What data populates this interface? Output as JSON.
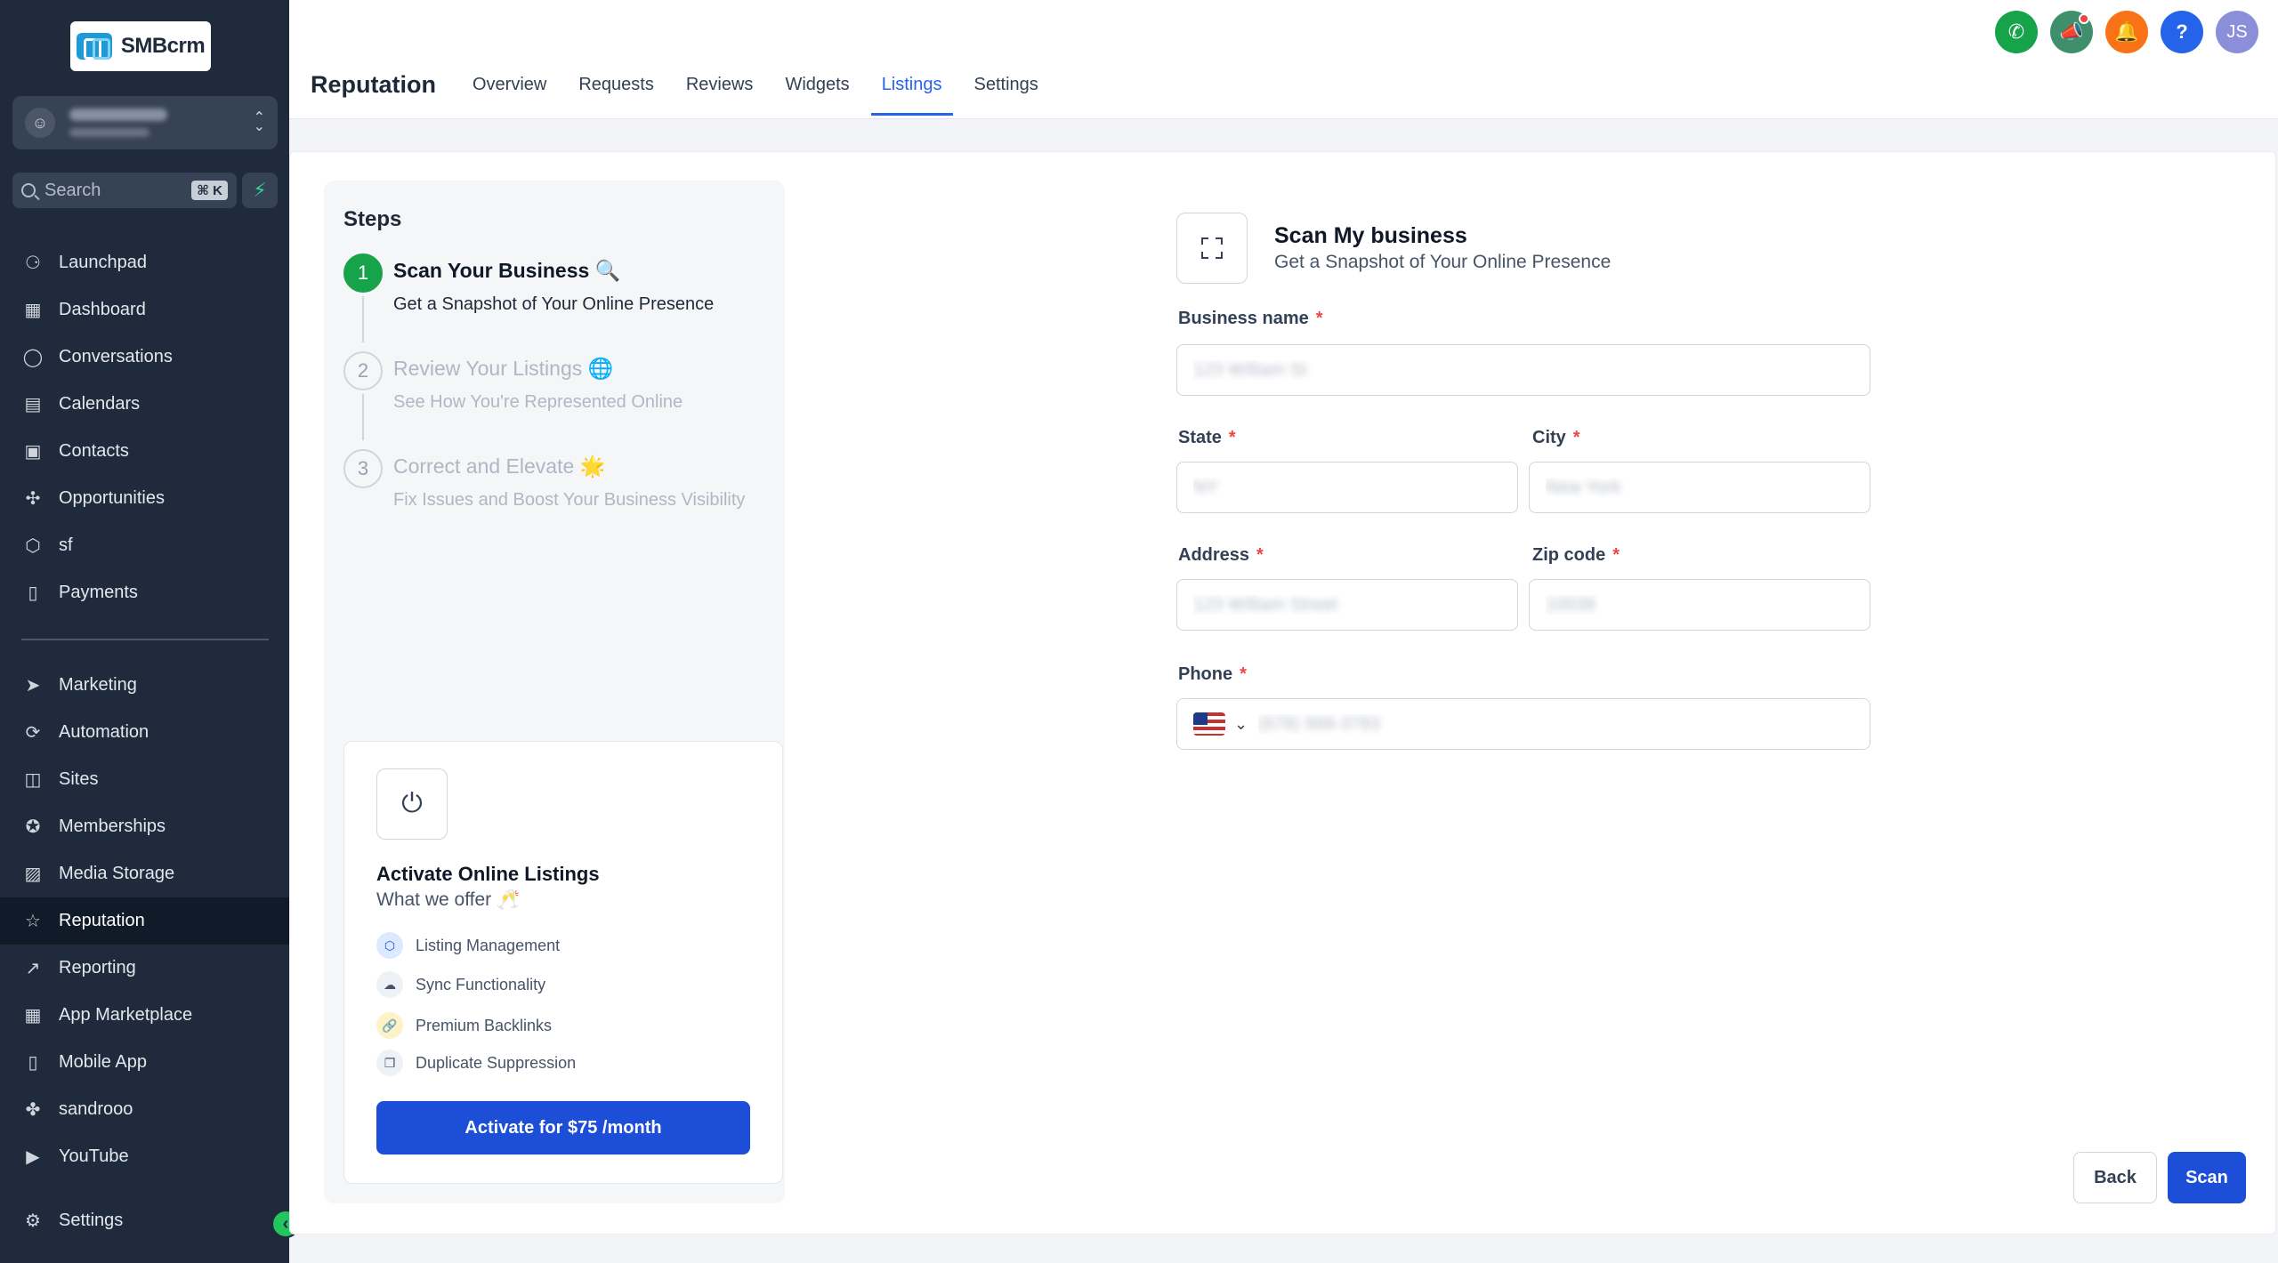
{
  "brand": {
    "name": "SMBcrm"
  },
  "search": {
    "label": "Search",
    "shortcut": "⌘ K"
  },
  "sidebar": {
    "items": [
      {
        "label": "Launchpad",
        "icon": "rocket-icon"
      },
      {
        "label": "Dashboard",
        "icon": "grid-icon"
      },
      {
        "label": "Conversations",
        "icon": "chat-icon"
      },
      {
        "label": "Calendars",
        "icon": "calendar-icon"
      },
      {
        "label": "Contacts",
        "icon": "contacts-icon"
      },
      {
        "label": "Opportunities",
        "icon": "opportunities-icon"
      },
      {
        "label": "sf",
        "icon": "cube-icon"
      },
      {
        "label": "Payments",
        "icon": "payments-icon"
      }
    ],
    "items2": [
      {
        "label": "Marketing",
        "icon": "send-icon"
      },
      {
        "label": "Automation",
        "icon": "automation-icon"
      },
      {
        "label": "Sites",
        "icon": "sites-icon"
      },
      {
        "label": "Memberships",
        "icon": "award-icon"
      },
      {
        "label": "Media Storage",
        "icon": "image-icon"
      },
      {
        "label": "Reputation",
        "icon": "star-icon"
      },
      {
        "label": "Reporting",
        "icon": "trend-icon"
      },
      {
        "label": "App Marketplace",
        "icon": "apps-icon"
      },
      {
        "label": "Mobile App",
        "icon": "mobile-icon"
      },
      {
        "label": "sandrooo",
        "icon": "sandrooo-icon"
      },
      {
        "label": "YouTube",
        "icon": "youtube-icon"
      }
    ],
    "settings": "Settings"
  },
  "header": {
    "title": "Reputation",
    "tabs": [
      "Overview",
      "Requests",
      "Reviews",
      "Widgets",
      "Listings",
      "Settings"
    ],
    "active_tab": "Listings",
    "avatar_initials": "JS"
  },
  "steps": {
    "title": "Steps",
    "items": [
      {
        "num": "1",
        "title": "Scan Your Business 🔍",
        "desc": "Get a Snapshot of Your Online Presence"
      },
      {
        "num": "2",
        "title": "Review Your Listings 🌐",
        "desc": "See How You're Represented Online"
      },
      {
        "num": "3",
        "title": "Correct and Elevate 🌟",
        "desc": "Fix Issues and Boost Your Business Visibility"
      }
    ]
  },
  "activate": {
    "title": "Activate Online Listings",
    "subtitle": "What we offer 🥂",
    "features": [
      "Listing Management",
      "Sync Functionality",
      "Premium Backlinks",
      "Duplicate Suppression"
    ],
    "button": "Activate for $75 /month"
  },
  "form": {
    "heading": "Scan My business",
    "subheading": "Get a Snapshot of Your Online Presence",
    "business_name_label": "Business name",
    "business_name_value": "123 William St",
    "state_label": "State",
    "state_value": "NY",
    "city_label": "City",
    "city_value": "New York",
    "address_label": "Address",
    "address_value": "123 William Street",
    "zip_label": "Zip code",
    "zip_value": "10038",
    "phone_label": "Phone",
    "phone_value": "(678) 999-3783",
    "required_mark": "*",
    "back": "Back",
    "scan": "Scan"
  }
}
